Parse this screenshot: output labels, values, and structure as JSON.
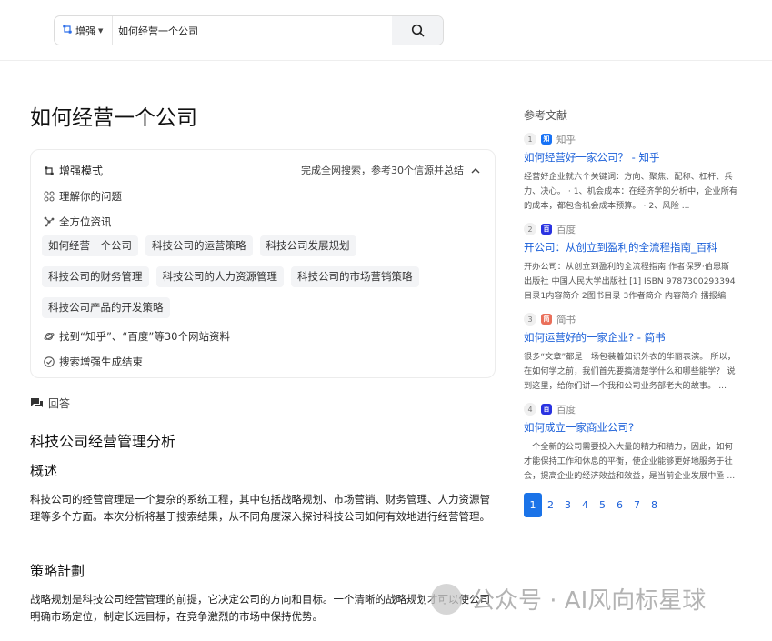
{
  "search": {
    "mode_label": "增强",
    "query": "如何经营一个公司"
  },
  "main": {
    "title": "如何经营一个公司",
    "enhance": {
      "mode_label": "增强模式",
      "summary": "完成全网搜索，参考30个信源并总结",
      "step_understand": "理解你的问题",
      "step_info": "全方位资讯",
      "keywords": [
        "如何经营一个公司",
        "科技公司的运营策略",
        "科技公司发展规划",
        "科技公司的财务管理",
        "科技公司的人力资源管理",
        "科技公司的市场营销策略",
        "科技公司产品的开发策略"
      ],
      "step_found": "找到“知乎”、“百度”等30个网站资料",
      "step_done": "搜索增强生成结束"
    },
    "answer_label": "回答",
    "answer_title": "科技公司经营管理分析",
    "section1_title": "概述",
    "section1_text": "科技公司的经营管理是一个复杂的系统工程，其中包括战略规划、市场营销、财务管理、人力资源管理等多个方面。本次分析将基于搜索结果，从不同角度深入探讨科技公司如何有效地进行经营管理。",
    "section2_title": "策略計劃",
    "section2_text": "战略规划是科技公司经营管理的前提，它决定公司的方向和目标。一个清晰的战略规划才可以使公司明确市场定位，制定长远目标，在竞争激烈的市场中保持优势。"
  },
  "references": {
    "title": "参考文献",
    "items": [
      {
        "num": "1",
        "source": "知乎",
        "icon_char": "知",
        "icon_color": "#1772f6",
        "link": "如何经营好一家公司？ - 知乎",
        "snippet": "经营好企业就六个关键词：方向、聚焦、配称、杠杆、兵力、决心。 · 1、机会成本：在经济学的分析中，企业所有的成本，都包含机会成本预算。 · 2、风险 ..."
      },
      {
        "num": "2",
        "source": "百度",
        "icon_char": "百",
        "icon_color": "#2932e1",
        "link": "开公司：从创立到盈利的全流程指南_百科",
        "snippet": "开办公司：从创立到盈利的全流程指南 作者保罗·伯恩斯 出版社 中国人民大学出版社 [1] ISBN 9787300293394 目录1内容简介 2图书目录 3作者简介 内容简介 播报编辑..."
      },
      {
        "num": "3",
        "source": "简书",
        "icon_char": "简",
        "icon_color": "#ea6f5a",
        "link": "如何运营好的一家企业? - 简书",
        "snippet": "很多“文章”都是一场包装着知识外衣的华丽表演。 所以，在如何学之前，我们首先要搞清楚学什么和哪些能学？ 说到这里，给你们讲一个我和公司业务部老大的故事。 ..."
      },
      {
        "num": "4",
        "source": "百度",
        "icon_char": "百",
        "icon_color": "#2932e1",
        "link": "如何成立一家商业公司?",
        "snippet": "一个全新的公司需要投入大量的精力和精力，因此，如何才能保持工作和休息的平衡，使企业能够更好地服务于社会，提高企业的经济效益和效益，是当前企业发展中亟 ..."
      }
    ]
  },
  "pagination": {
    "pages": [
      "1",
      "2",
      "3",
      "4",
      "5",
      "6",
      "7",
      "8"
    ],
    "active": "1"
  },
  "watermark": {
    "text": "公众号 · AI风向标星球"
  }
}
